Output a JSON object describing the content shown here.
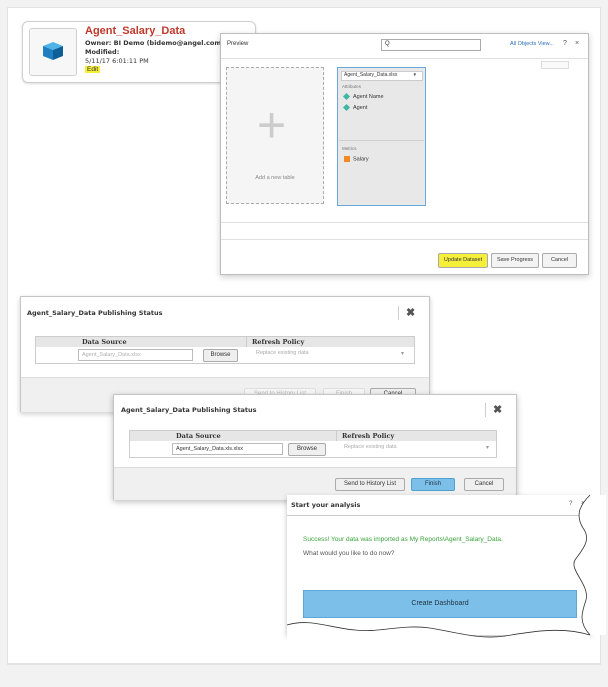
{
  "object_card": {
    "title": "Agent_Salary_Data",
    "owner": "Owner:   BI Demo (bidemo@angel.com)",
    "modified_label": "Modified:",
    "modified_value": "5/11/17 6:01:11 PM",
    "edit_link": "Edit",
    "icon": "cube-icon"
  },
  "preview": {
    "title": "Preview",
    "search_placeholder": "Q",
    "all_objects_link": "All Objects View...",
    "help": "?",
    "close": "×",
    "add_table_text": "Add a new table",
    "dataset_file": "Agent_Salary_Data.xlsx",
    "attributes_label": "Attributes",
    "attributes": [
      "Agent Name",
      "Agent"
    ],
    "metrics_label": "Metrics",
    "metrics": [
      "Salary"
    ],
    "buttons": {
      "update": "Update Dataset",
      "save": "Save Progress",
      "cancel": "Cancel"
    }
  },
  "publish1": {
    "title": "Agent_Salary_Data Publishing Status",
    "col_source": "Data Source",
    "col_policy": "Refresh Policy",
    "source_value": "Agent_Salary_Data.xlsx",
    "browse": "Browse",
    "policy_value": "Replace existing data",
    "send_history": "Send to History List",
    "finish": "Finish",
    "cancel": "Cancel",
    "close": "✖"
  },
  "publish2": {
    "title": "Agent_Salary_Data Publishing Status",
    "col_source": "Data Source",
    "col_policy": "Refresh Policy",
    "source_value": "Agent_Salary_Data.xls.xlsx",
    "browse": "Browse",
    "policy_value": "Replace existing data",
    "send_history": "Send to History List",
    "finish": "Finish",
    "cancel": "Cancel",
    "close": "✖"
  },
  "start": {
    "title": "Start your analysis",
    "help": "?",
    "close": "×",
    "success_msg": "Success! Your data was imported as My Reports\\Agent_Salary_Data.",
    "question": "What would you like to do now?",
    "create_dashboard": "Create Dashboard"
  },
  "colors": {
    "highlight": "#f5ef3a",
    "accent_blue": "#7cc0ea",
    "title_red": "#c0392b",
    "success_green": "#3aa33a"
  }
}
